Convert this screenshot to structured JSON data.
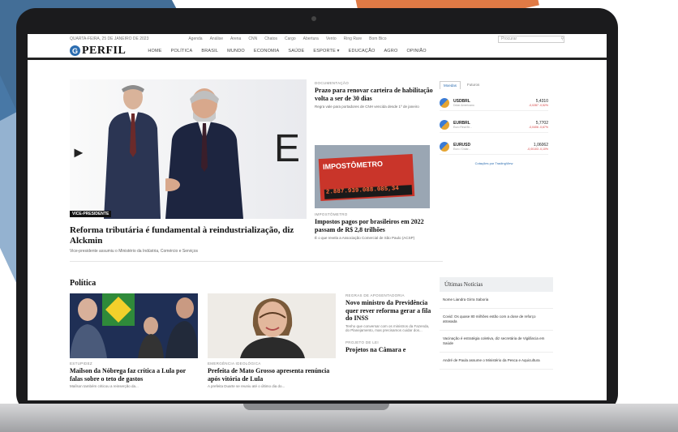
{
  "site": {
    "date": "QUARTA-FEIRA, 25 DE JANEIRO DE 2023",
    "topnav": [
      "Agenda",
      "Análise",
      "Arena",
      "CNN",
      "Chatos",
      "Cargo",
      "Abertura",
      "Vento",
      "Ring Rare",
      "Bom Bico"
    ],
    "search_placeholder": "Procurar",
    "logo_letter": "G",
    "logo_text": "PERFIL",
    "nav": [
      "HOME",
      "POLÍTICA",
      "BRASIL",
      "MUNDO",
      "ECONOMIA",
      "SAÚDE",
      "ESPORTE ▾",
      "EDUCAÇÃO",
      "AGRO",
      "OPINIÃO"
    ]
  },
  "hero": {
    "tag": "VICE-PRESIDENTE",
    "title": "Reforma tributária é fundamental à reindustrialização, diz Alckmin",
    "subtitle": "Vice-presidente assumiu o Ministério da Indústria, Comércio e Serviços"
  },
  "side_articles": [
    {
      "kicker": "DOCUMENTAÇÃO",
      "title": "Prazo para renovar carteira de habilitação volta a ser de 30 dias",
      "subtitle": "Regra vale para portadores de CNH vencida desde 1º de janeiro"
    },
    {
      "kicker": "IMPOSTÔMETRO",
      "title": "Impostos pagos por brasileiros em 2022 passam de R$ 2,8 trilhões",
      "subtitle": "É o que revela a Associação Comercial de São Paulo (ACSP)"
    }
  ],
  "impostometro": {
    "board_text": "IMPOSTÔMETRO",
    "board_number": "2.887.939.088.085,34"
  },
  "market_widget": {
    "tabs": [
      "Moedas",
      "Futuros"
    ],
    "quotes": [
      {
        "name": "USDBRL",
        "desc": "Dólar Americano",
        "value": "5,4310",
        "change": "-0,0287 -0,52%"
      },
      {
        "name": "EURBRL",
        "desc": "Euro Real Br...",
        "value": "5,7702",
        "change": "-0,0406 -0,67%"
      },
      {
        "name": "EURUSD",
        "desc": "Euro / Dólar...",
        "value": "1,06062",
        "change": "-0,00103 -0,10%"
      }
    ],
    "footer": "Cotações por TradingView"
  },
  "politics": {
    "heading": "Política",
    "cards": [
      {
        "kicker": "ESTUPIDEZ",
        "title": "Maílson da Nóbrega faz crítica a Lula por falas sobre o teto de gastos",
        "subtitle": "Maílson também criticou a reinserção da..."
      },
      {
        "kicker": "EMERGÊNCIA IDEOLÓGICA",
        "title": "Prefeita de Mato Grosso apresenta renúncia após vitória de Lula",
        "subtitle": "A prefeita Duarte se reuniu até o último dia do..."
      },
      {
        "kicker": "REGRAS DE APOSENTADORIA",
        "title": "Novo ministro da Previdência quer rever reforma gerar a fila do INSS",
        "subtitle": "Tenho que conversar com os ministros da Fazenda, do Planejamento, mas precisamos cuidar dos..."
      }
    ],
    "extra": {
      "kicker": "PROJETO DE LEI",
      "title": "Projetos na Câmara e"
    }
  },
  "latest": {
    "heading": "Últimas Notícias",
    "items": [
      "Nome Liandra Girra Saboria",
      "Covid: Os quase 80 milhões estão com a dose de reforço atrasada",
      "Vacinação é estratégia coletiva, diz secretária de Vigilância em Saúde",
      "André de Paula assume o Ministério da Pesca e Aquicultura"
    ]
  }
}
